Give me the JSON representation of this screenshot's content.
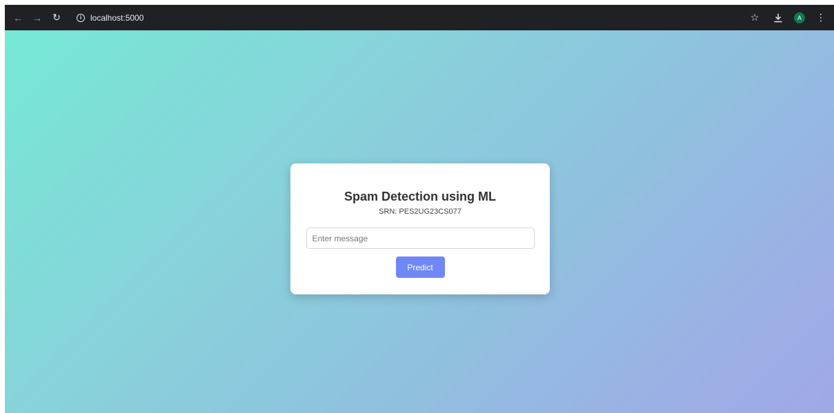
{
  "browser": {
    "back_icon": "arrow-left-icon",
    "forward_icon": "arrow-right-icon",
    "reload_icon": "reload-icon",
    "url": "localhost:5000",
    "bookmark_icon": "star-icon",
    "download_icon": "download-icon",
    "profile_initial": "A",
    "menu_icon": "kebab-menu-icon"
  },
  "card": {
    "title": "Spam Detection using ML",
    "srn": "SRN: PES2UG23CS077",
    "message_value": "",
    "message_placeholder": "Enter message",
    "predict_label": "Predict"
  },
  "colors": {
    "toolbar_bg": "#202124",
    "gradient_start": "#76e8d6",
    "gradient_end": "#a0a8e6",
    "button_bg": "#6f87f7",
    "avatar_bg": "#0f7a4c"
  }
}
